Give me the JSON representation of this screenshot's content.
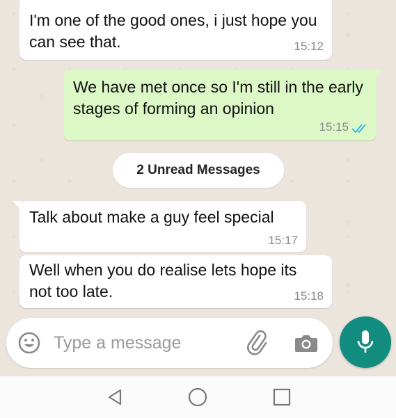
{
  "messages": [
    {
      "direction": "in",
      "text": "I'm one of the good ones, i just hope you can see that.",
      "time": "15:12"
    },
    {
      "direction": "out",
      "text": "We have met once so I'm still in the early stages of forming an opinion",
      "time": "15:15",
      "status": "read"
    },
    {
      "direction": "in",
      "text": "Talk about make a guy feel special",
      "time": "15:17"
    },
    {
      "direction": "in",
      "text": "Well when you do realise lets hope its not too late.",
      "time": "15:18"
    }
  ],
  "unread_banner": "2 Unread Messages",
  "input": {
    "placeholder": "Type a message"
  },
  "icons": {
    "emoji": "emoji-icon",
    "attach": "paperclip-icon",
    "camera": "camera-icon",
    "mic": "mic-icon",
    "read_receipt": "double-check-icon",
    "nav_back": "back-triangle-icon",
    "nav_home": "home-circle-icon",
    "nav_recents": "recents-square-icon"
  },
  "colors": {
    "chat_background": "#ece5dd",
    "outgoing_bubble": "#dcf8c6",
    "incoming_bubble": "#ffffff",
    "read_ticks": "#34b7f1",
    "mic_button": "#128c7e"
  }
}
